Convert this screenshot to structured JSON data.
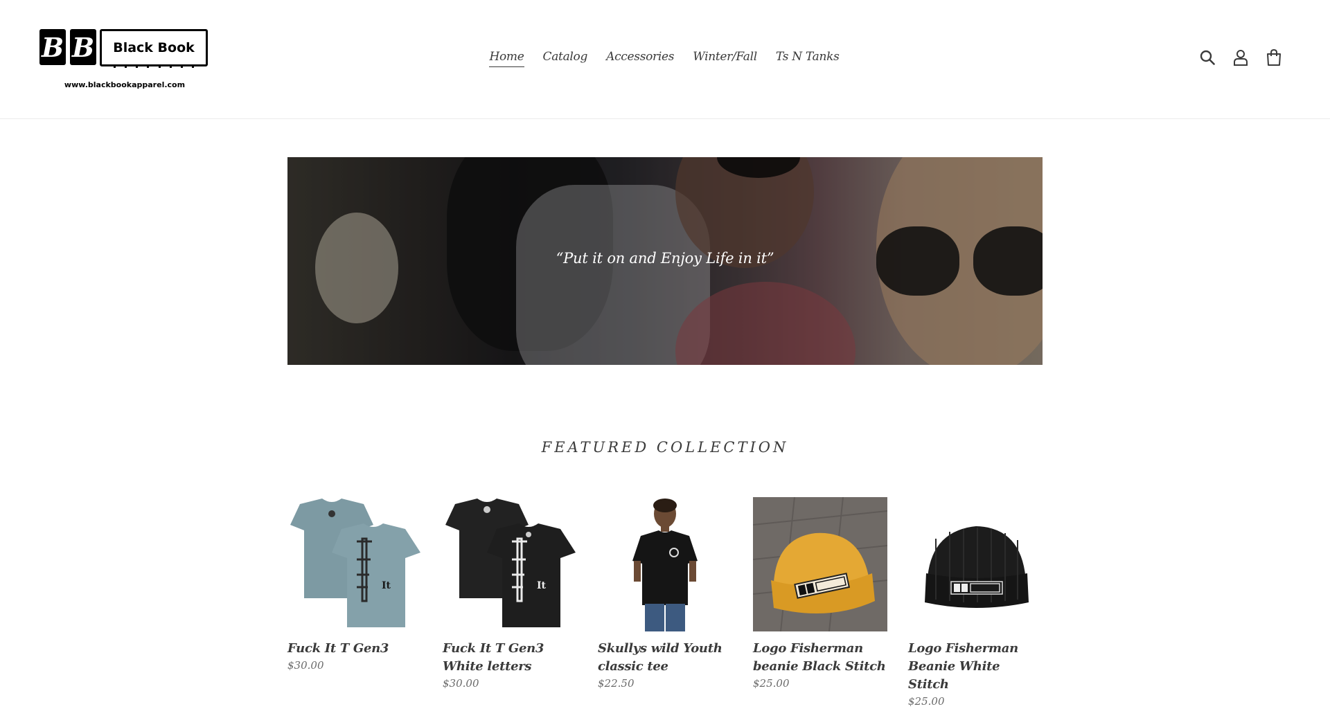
{
  "header": {
    "logo": {
      "letters": [
        "B",
        "B"
      ],
      "brand": "Black Book",
      "url": "www.blackbookapparel.com"
    },
    "nav": [
      {
        "label": "Home",
        "active": true
      },
      {
        "label": "Catalog",
        "active": false
      },
      {
        "label": "Accessories",
        "active": false
      },
      {
        "label": "Winter/Fall",
        "active": false
      },
      {
        "label": "Ts N Tanks",
        "active": false
      }
    ],
    "icons": [
      "search-icon",
      "account-icon",
      "cart-icon"
    ]
  },
  "hero": {
    "caption": "“Put it on and Enjoy Life in it”"
  },
  "featured": {
    "title": "FEATURED COLLECTION",
    "products": [
      {
        "title": "Fuck It T Gen3",
        "price": "$30.00",
        "image": "two-slate-blue-tees"
      },
      {
        "title": "Fuck It T Gen3 White letters",
        "price": "$30.00",
        "image": "two-black-tees"
      },
      {
        "title": "Skullys wild Youth classic tee",
        "price": "$22.50",
        "image": "youth-model-black-tee"
      },
      {
        "title": "Logo Fisherman beanie Black Stitch",
        "price": "$25.00",
        "image": "mustard-beanie"
      },
      {
        "title": "Logo Fisherman Beanie White Stitch",
        "price": "$25.00",
        "image": "black-beanie"
      }
    ]
  },
  "colors": {
    "text": "#3a3a3a",
    "price": "#6a6a6a",
    "border": "#ebebeb"
  }
}
